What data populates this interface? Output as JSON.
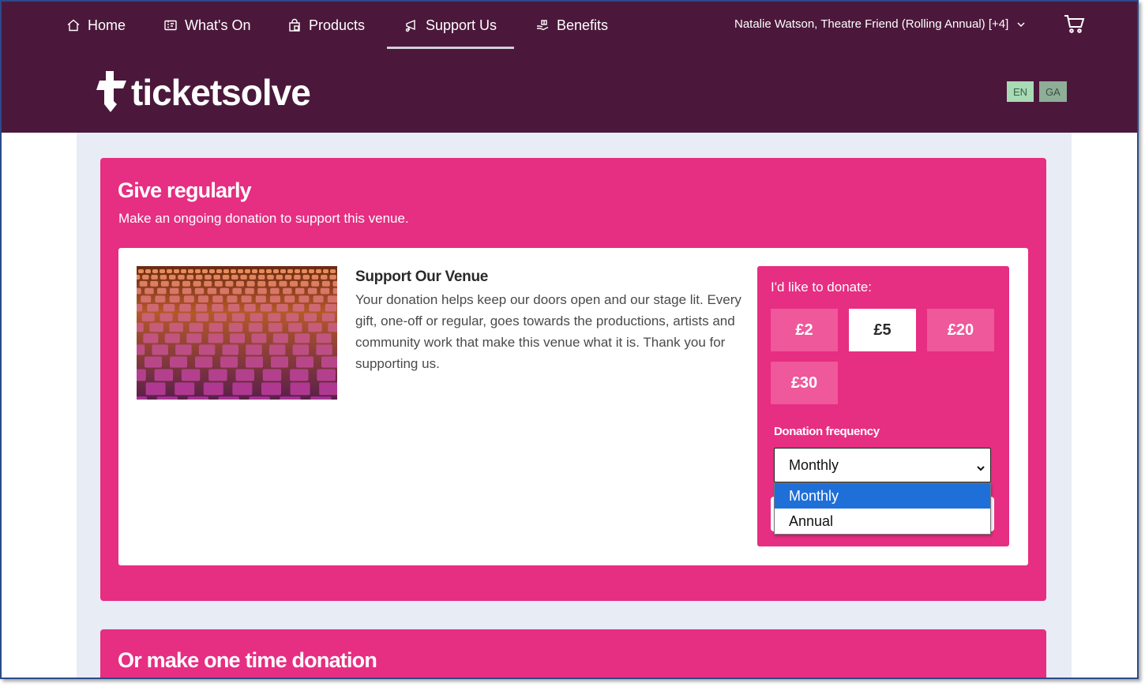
{
  "nav": {
    "items": [
      {
        "label": "Home",
        "icon": "home-icon"
      },
      {
        "label": "What's On",
        "icon": "ticket-icon"
      },
      {
        "label": "Products",
        "icon": "shopping-bag-icon"
      },
      {
        "label": "Support Us",
        "icon": "megaphone-icon",
        "active": true
      },
      {
        "label": "Benefits",
        "icon": "hand-gift-icon"
      }
    ],
    "user": "Natalie Watson, Theatre Friend (Rolling Annual) [+4]",
    "cart_icon": "cart-icon"
  },
  "brand": {
    "name": "ticketsolve",
    "header_color": "#4b183b",
    "accent_color": "#e62e82"
  },
  "languages": [
    "EN",
    "GA"
  ],
  "give_regularly": {
    "title": "Give regularly",
    "subtitle": "Make an ongoing donation to support this venue.",
    "support_title": "Support Our Venue",
    "support_text": "Your donation helps keep our doors open and our stage lit. Every gift, one-off or regular, goes towards the productions, artists and community work that make this venue what it is. Thank you for supporting us.",
    "donate_label": "I'd like to donate:",
    "amounts": [
      {
        "label": "£2",
        "selected": false
      },
      {
        "label": "£5",
        "selected": true
      },
      {
        "label": "£20",
        "selected": false
      },
      {
        "label": "£30",
        "selected": false
      }
    ],
    "frequency_label": "Donation frequency",
    "frequency_value": "Monthly",
    "frequency_options": [
      "Monthly",
      "Annual"
    ],
    "highlighted_option": "Monthly"
  },
  "one_time": {
    "title": "Or make one time donation"
  }
}
